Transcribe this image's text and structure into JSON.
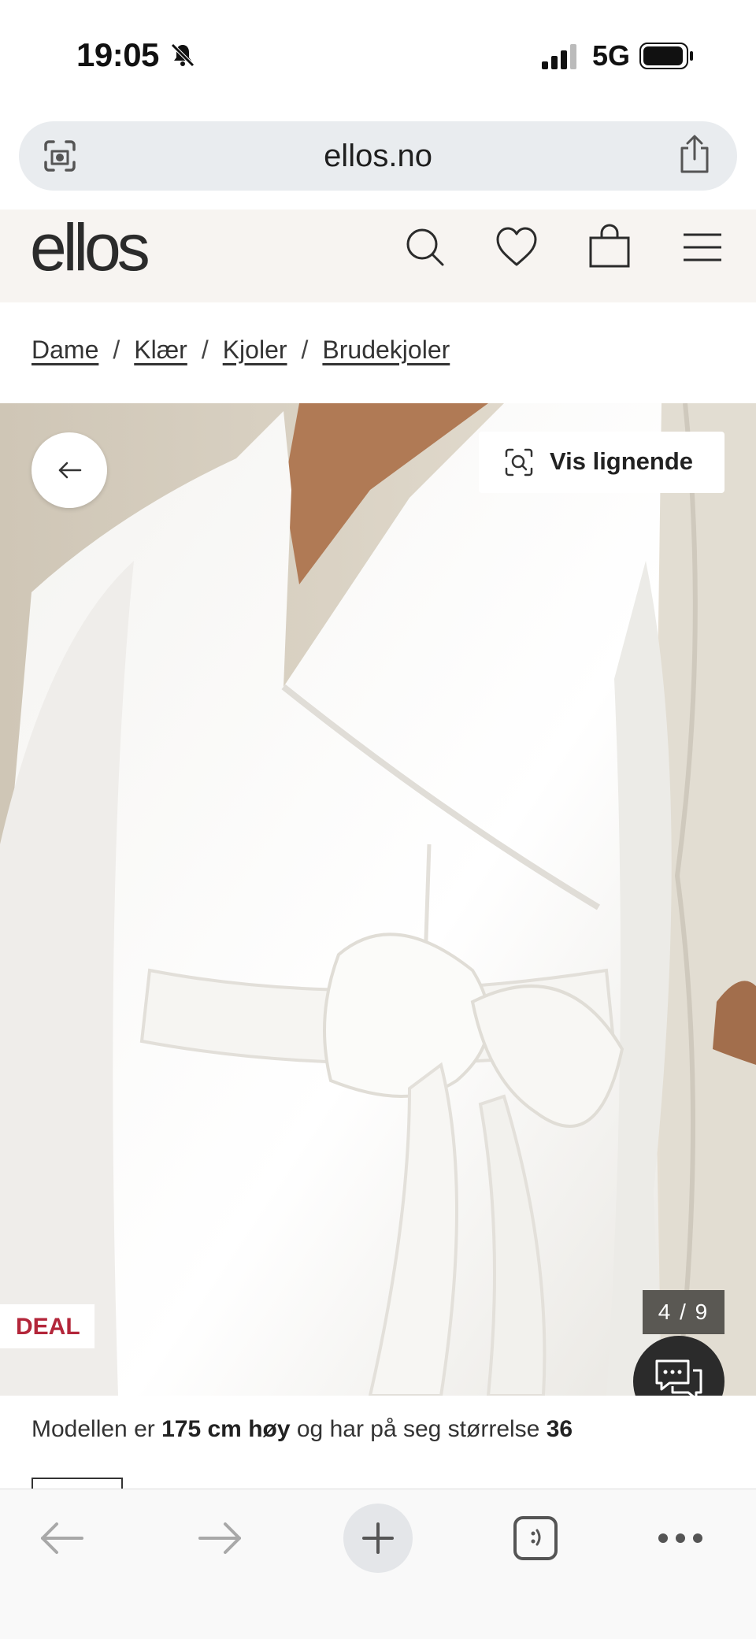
{
  "status_bar": {
    "time": "19:05",
    "network": "5G",
    "icons": [
      "bell-slash-icon",
      "signal-icon",
      "battery-icon"
    ]
  },
  "browser": {
    "url": "ellos.no",
    "icons": [
      "visual-search-icon",
      "share-icon"
    ]
  },
  "header": {
    "logo": "ellos",
    "icons": [
      "search-icon",
      "heart-icon",
      "bag-icon",
      "menu-icon"
    ]
  },
  "breadcrumb": {
    "items": [
      "Dame",
      "Klær",
      "Kjoler",
      "Brudekjoler"
    ],
    "separator": "/"
  },
  "gallery": {
    "similar_label": "Vis lignende",
    "badge": "DEAL",
    "pager": "4 / 9",
    "colors": {
      "badge_text": "#b3263a",
      "pager_bg": "#5a5853",
      "chat_bg": "#2b2b2b"
    }
  },
  "model_info": {
    "prefix": "Modellen er",
    "height": "175 cm høy",
    "middle": "og har på seg størrelse",
    "size": "36"
  },
  "bottom_toolbar": {
    "icons": [
      "back-arrow-icon",
      "forward-arrow-icon",
      "plus-icon",
      "tabs-icon",
      "more-icon"
    ]
  }
}
